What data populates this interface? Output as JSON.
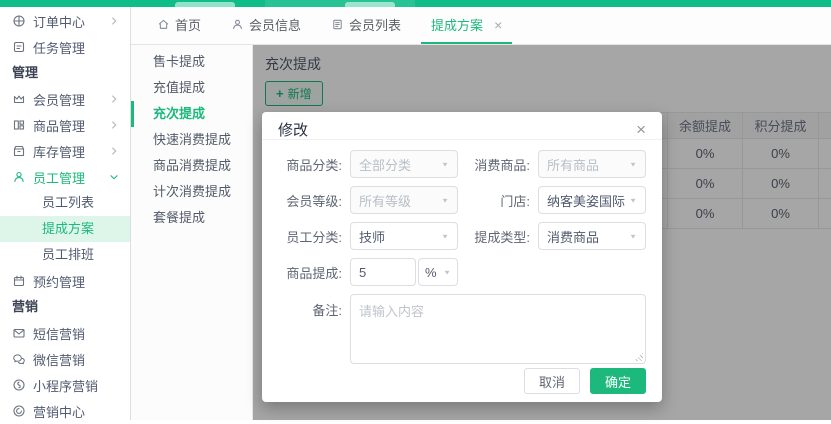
{
  "colors": {
    "accent": "#1db97c",
    "accent_light": "#def5ea",
    "topbar": "#0fbd88",
    "overlay": "rgba(0,0,0,0.35)"
  },
  "sidebar": {
    "items": [
      {
        "label": "订单中心",
        "icon": "globe-icon",
        "chevron": "right"
      },
      {
        "label": "任务管理",
        "icon": "task-icon"
      },
      {
        "label": "管理",
        "type": "section"
      },
      {
        "label": "会员管理",
        "icon": "crown-icon",
        "chevron": "right"
      },
      {
        "label": "商品管理",
        "icon": "goods-icon",
        "chevron": "right"
      },
      {
        "label": "库存管理",
        "icon": "inventory-icon",
        "chevron": "right"
      },
      {
        "label": "员工管理",
        "icon": "person-icon",
        "chevron": "down",
        "active": true
      },
      {
        "label": "员工列表",
        "type": "sub"
      },
      {
        "label": "提成方案",
        "type": "sub",
        "selected": true
      },
      {
        "label": "员工排班",
        "type": "sub"
      },
      {
        "label": "预约管理",
        "icon": "calendar-icon"
      },
      {
        "label": "营销",
        "type": "section"
      },
      {
        "label": "短信营销",
        "icon": "mail-icon"
      },
      {
        "label": "微信营销",
        "icon": "wechat-icon"
      },
      {
        "label": "小程序营销",
        "icon": "miniprogram-icon"
      },
      {
        "label": "营销中心",
        "icon": "marketing-icon"
      }
    ]
  },
  "tabs": [
    {
      "label": "首页",
      "icon": "home-icon"
    },
    {
      "label": "会员信息",
      "icon": "user-icon"
    },
    {
      "label": "会员列表",
      "icon": "list-icon"
    },
    {
      "label": "提成方案",
      "active": true,
      "closable": true
    }
  ],
  "submenu": {
    "items": [
      {
        "label": "售卡提成"
      },
      {
        "label": "充值提成"
      },
      {
        "label": "充次提成",
        "active": true
      },
      {
        "label": "快速消费提成"
      },
      {
        "label": "商品消费提成"
      },
      {
        "label": "计次消费提成"
      },
      {
        "label": "套餐提成"
      }
    ]
  },
  "content": {
    "title": "充次提成",
    "add_button": "新增",
    "table": {
      "headers": [
        "余额提成",
        "积分提成"
      ],
      "rows": [
        [
          "0%",
          "0%"
        ],
        [
          "0%",
          "0%"
        ],
        [
          "0%",
          "0%"
        ]
      ]
    }
  },
  "modal": {
    "title": "修改",
    "fields": [
      {
        "label": "商品分类:",
        "value": "全部分类",
        "disabled": true
      },
      {
        "label": "消费商品:",
        "value": "所有商品",
        "disabled": true
      },
      {
        "label": "会员等级:",
        "value": "所有等级",
        "disabled": true
      },
      {
        "label": "门店:",
        "value": "纳客美姿国际",
        "disabled": false
      },
      {
        "label": "员工分类:",
        "value": "技师",
        "disabled": false
      },
      {
        "label": "提成类型:",
        "value": "消费商品",
        "disabled": false
      }
    ],
    "commission": {
      "label": "商品提成:",
      "value": "5",
      "unit": "%"
    },
    "note": {
      "label": "备注:",
      "placeholder": "请输入内容"
    },
    "cancel_label": "取消",
    "ok_label": "确定"
  }
}
